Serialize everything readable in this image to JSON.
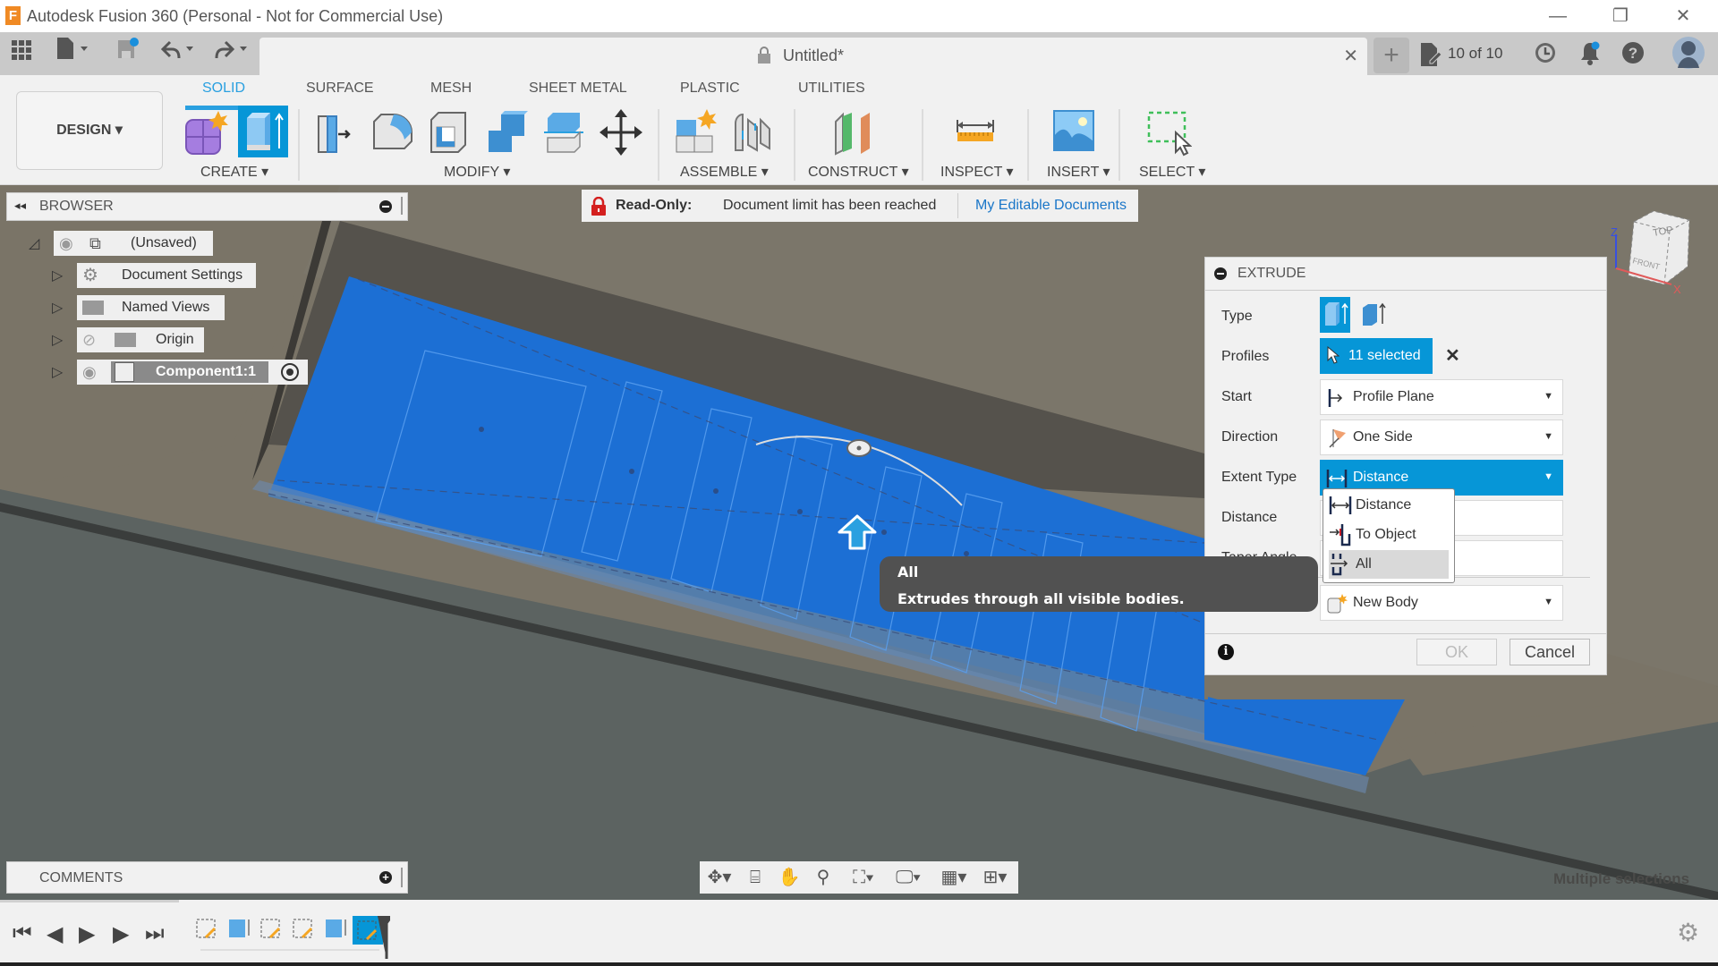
{
  "window": {
    "title": "Autodesk Fusion 360 (Personal - Not for Commercial Use)",
    "logo_letter": "F",
    "minimize": "—",
    "maximize": "❐",
    "close": "✕"
  },
  "appbar": {
    "doc_title": "Untitled*",
    "doc_count": "10 of 10",
    "icons": [
      "grid-icon",
      "file-icon",
      "save-icon",
      "undo-icon",
      "redo-icon",
      "lock-icon",
      "close-icon",
      "new-tab-icon",
      "doc-count-icon",
      "job-status-icon",
      "notifications-icon",
      "help-icon",
      "avatar"
    ]
  },
  "toolbar": {
    "workspace": "DESIGN ▾",
    "tabs": [
      {
        "label": "SOLID",
        "active": true
      },
      {
        "label": "SURFACE",
        "active": false
      },
      {
        "label": "MESH",
        "active": false
      },
      {
        "label": "SHEET METAL",
        "active": false
      },
      {
        "label": "PLASTIC",
        "active": false
      },
      {
        "label": "UTILITIES",
        "active": false
      }
    ],
    "groups": {
      "create": "CREATE ▾",
      "modify": "MODIFY ▾",
      "assemble": "ASSEMBLE ▾",
      "construct": "CONSTRUCT ▾",
      "inspect": "INSPECT ▾",
      "insert": "INSERT ▾",
      "select": "SELECT ▾"
    },
    "accent": "#0696d7"
  },
  "browser": {
    "title": "BROWSER",
    "items": [
      {
        "label": "(Unsaved)"
      },
      {
        "label": "Document Settings"
      },
      {
        "label": "Named Views"
      },
      {
        "label": "Origin"
      },
      {
        "label": "Component1:1"
      }
    ]
  },
  "banner": {
    "label": "Read-Only:",
    "message": "Document limit has been reached",
    "link": "My Editable Documents"
  },
  "extrude": {
    "title": "EXTRUDE",
    "type_label": "Type",
    "profiles_label": "Profiles",
    "profiles_value": "11 selected",
    "start_label": "Start",
    "start_value": "Profile Plane",
    "direction_label": "Direction",
    "direction_value": "One Side",
    "extent_label": "Extent Type",
    "extent_value": "Distance",
    "distance_label": "Distance",
    "taper_label": "Taper Angle",
    "operation_value": "New Body",
    "ok": "OK",
    "cancel": "Cancel",
    "extent_options": [
      "Distance",
      "To Object",
      "All"
    ],
    "highlighted_option": "All"
  },
  "tooltip": {
    "title": "All",
    "body": "Extrudes through all visible bodies."
  },
  "viewcube": {
    "top": "TOP",
    "front": "FRONT",
    "z": "Z",
    "x": "X"
  },
  "comments": {
    "title": "COMMENTS"
  },
  "viewport_status": "Multiple selections"
}
